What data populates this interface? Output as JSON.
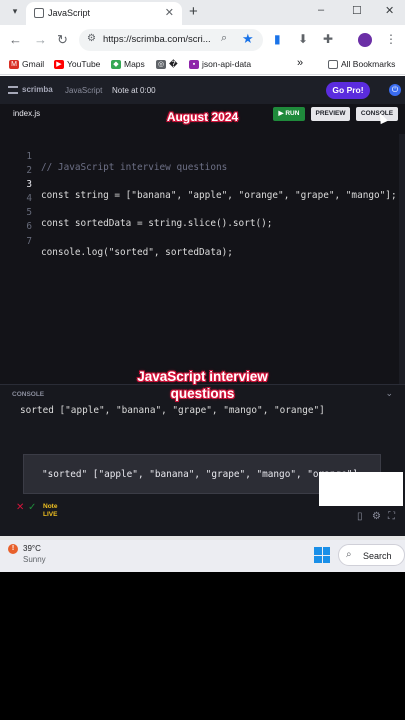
{
  "browser": {
    "tab_title": "JavaScript",
    "tab_close": "✕",
    "new_tab": "+",
    "url": "https://scrimba.com/scri...",
    "window_controls": {
      "minimize": "–",
      "maximize": "☐",
      "close": "✕"
    },
    "nav": {
      "back": "←",
      "forward": "→",
      "reload": "↻"
    },
    "bookmarks": [
      {
        "label": "Gmail",
        "icon": "gmail-icon",
        "color": "#d93025",
        "glyph": "M"
      },
      {
        "label": "YouTube",
        "icon": "youtube-icon",
        "color": "#ff0000",
        "glyph": "▶"
      },
      {
        "label": "Maps",
        "icon": "maps-icon",
        "color": "#34a853",
        "glyph": "◆"
      },
      {
        "label": "�",
        "icon": "globe-icon",
        "color": "#5f6368",
        "glyph": "◎"
      },
      {
        "label": "json-api-data",
        "icon": "bookmark-icon",
        "color": "#8e24aa",
        "glyph": "▪"
      }
    ],
    "more_bookmarks": "»",
    "all_bookmarks": "All Bookmarks"
  },
  "app": {
    "brand": "scrimba",
    "crumbs": [
      "JavaScript",
      "Note at 0:00"
    ],
    "gopro_label": "Go Pro!",
    "filename": "index.js",
    "run_label": "▶ RUN",
    "preview_label": "PREVIEW",
    "console_label": "CONSOLE",
    "overlay_date": "August 2024",
    "overlay_title_1": "JavaScript interview",
    "overlay_title_2": "questions",
    "line_numbers": [
      "1",
      "2",
      "3",
      "4",
      "5",
      "6",
      "7"
    ],
    "code_lines": [
      "// JavaScript interview questions",
      "",
      "const string = [\"banana\", \"apple\", \"orange\", \"grape\", \"mango\"];",
      "",
      "const sortedData = string.slice().sort();",
      "",
      "console.log(\"sorted\", sortedData);"
    ],
    "console_panel_label": "CONSOLE",
    "console_output": "sorted [\"apple\", \"banana\", \"grape\", \"mango\", \"orange\"]",
    "popup_output": "\"sorted\" [\"apple\", \"banana\", \"grape\", \"mango\", \"orange\"]",
    "note_label": "Note",
    "live_label": "LIVE"
  },
  "taskbar": {
    "temperature": "39°C",
    "condition": "Sunny",
    "search_label": "Search"
  }
}
